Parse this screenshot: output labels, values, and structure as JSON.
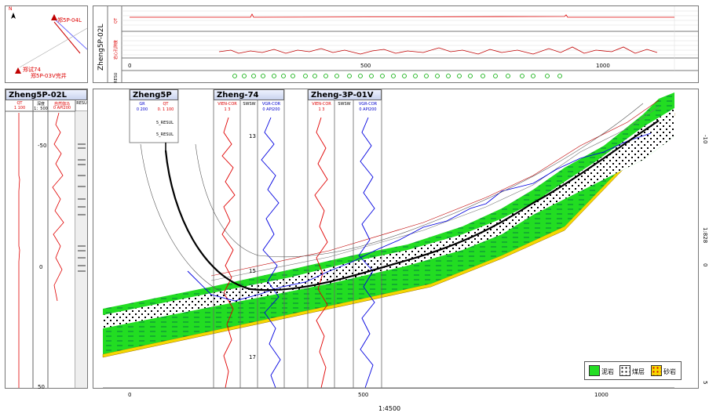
{
  "map": {
    "north": "N",
    "wells": [
      "郑5P-04L",
      "郑试74",
      "郑5P-03V完井"
    ]
  },
  "top_strip": {
    "well_label": "Zheng5P-02L",
    "track_labels": [
      "QT",
      "岩心孔隙度",
      "RESU"
    ],
    "x_ticks": [
      "0",
      "500",
      "1000"
    ]
  },
  "left_well": {
    "name": "Zheng5P-02L",
    "col_headers": [
      "QT",
      "深度",
      "自然伽马",
      "RESU"
    ],
    "col_sub": [
      "1  100",
      "1：500",
      "0  API200",
      ""
    ],
    "depth_ticks": [
      "-50",
      "0",
      "50"
    ]
  },
  "section": {
    "wells": [
      {
        "name": "Zheng5P",
        "headers": [
          "GR",
          "QT"
        ],
        "subs": [
          "0  200",
          "0. 1 100"
        ],
        "results": [
          "5_RESUL",
          "5_RESUL"
        ]
      },
      {
        "name": "Zheng-74",
        "headers": [
          "VIEN-COR",
          "SWSW",
          "VGR-COR"
        ],
        "subs": [
          "1  3",
          "",
          "0  API200"
        ],
        "marks": [
          "13",
          "15",
          "17"
        ]
      },
      {
        "name": "Zheng-3P-01V",
        "headers": [
          "VIEN-COR",
          "SWSW",
          "VGR-COR"
        ],
        "subs": [
          "1  3",
          "",
          "0  API200"
        ]
      }
    ],
    "x_ticks": [
      "0",
      "500",
      "1000"
    ],
    "scale": "1:4500",
    "right_ticks": [
      "-10",
      "1:828",
      "0",
      "5"
    ],
    "legend": [
      {
        "label": "泥岩",
        "color": "#22dd22"
      },
      {
        "label": "煤层",
        "color": "#ffffff"
      },
      {
        "label": "砂岩",
        "color": "#f5d800"
      }
    ]
  },
  "colors": {
    "mudstone": "#22dd22",
    "log_red": "#e00000",
    "log_blue": "#0000e0",
    "trajectory": "#000000"
  }
}
